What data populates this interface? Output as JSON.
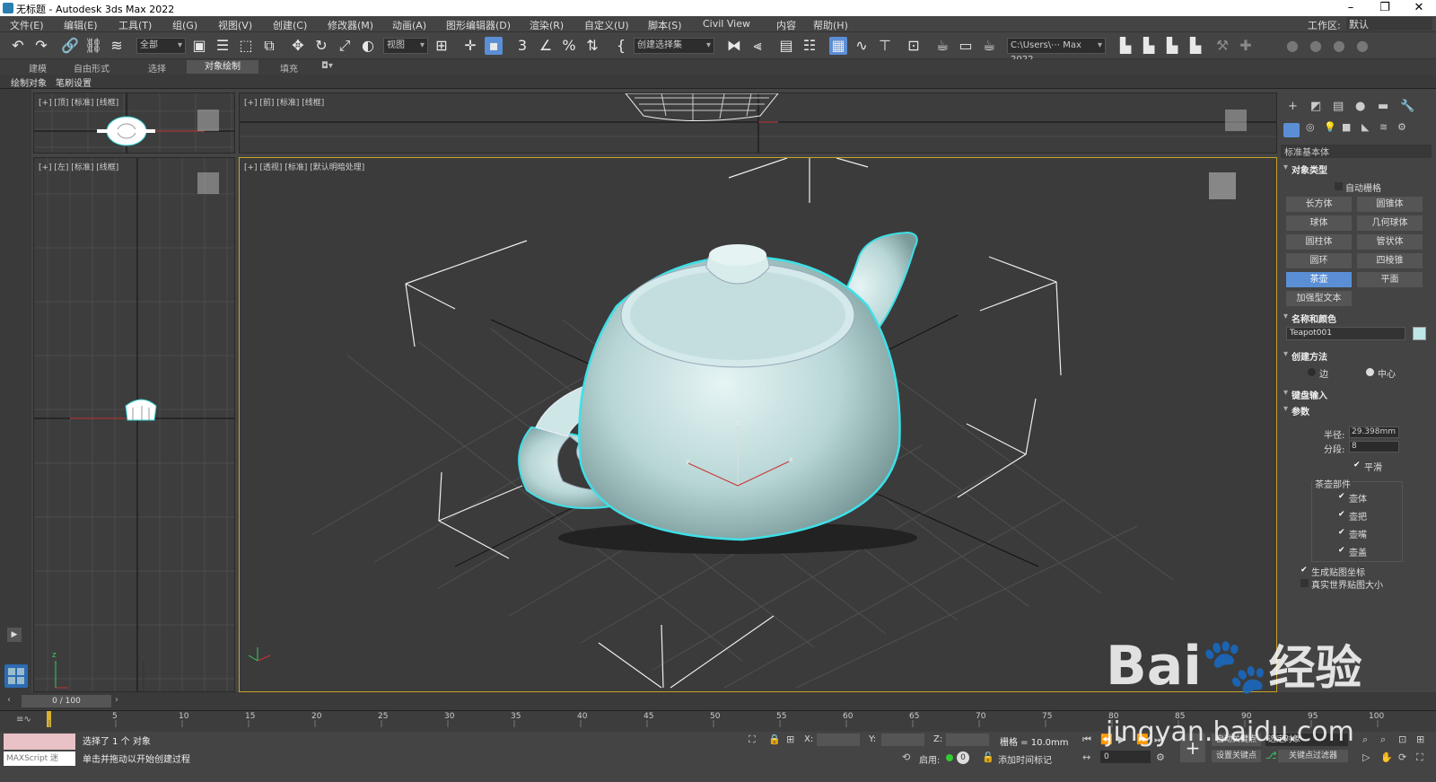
{
  "title": "无标题 - Autodesk 3ds Max 2022",
  "window_buttons": [
    "–",
    "❐",
    "✕"
  ],
  "menu": [
    "文件(E)",
    "编辑(E)",
    "工具(T)",
    "组(G)",
    "视图(V)",
    "创建(C)",
    "修改器(M)",
    "动画(A)",
    "图形编辑器(D)",
    "渲染(R)",
    "自定义(U)",
    "脚本(S)",
    "Civil View",
    "内容",
    "帮助(H)"
  ],
  "workspace": {
    "label": "工作区:",
    "value": "默认"
  },
  "toolbar": {
    "filter": "全部",
    "coord": "视图",
    "selection_set": "创建选择集",
    "path": "C:\\Users\\⋯ Max 2022",
    "snap_angle": "3"
  },
  "ribbon_tabs": [
    "建模",
    "自由形式",
    "选择",
    "对象绘制",
    "填充"
  ],
  "ribbon_active": "对象绘制",
  "subribbon": [
    "绘制对象",
    "笔刷设置"
  ],
  "viewports": {
    "top": "[+] [顶] [标准] [线框]",
    "front": "[+] [前] [标准] [线框]",
    "left": "[+] [左] [标准] [线框]",
    "persp": "[+] [透视] [标准] [默认明暗处理]"
  },
  "command_panel": {
    "category": "标准基本体",
    "object_type": "对象类型",
    "autogrid": "自动栅格",
    "objects": [
      "长方体",
      "圆锥体",
      "球体",
      "几何球体",
      "圆柱体",
      "管状体",
      "圆环",
      "四棱锥",
      "茶壶",
      "平面",
      "加强型文本"
    ],
    "selected_object": "茶壶",
    "name_color": "名称和颜色",
    "name": "Teapot001",
    "obj_color": "#bfe6e6",
    "creation_method": "创建方法",
    "method_edge": "边",
    "method_center": "中心",
    "keyboard_input": "键盘输入",
    "parameters": "参数",
    "radius_label": "半径:",
    "radius": "29.398mm",
    "segments_label": "分段:",
    "segments": "8",
    "smooth": "平滑",
    "parts_label": "茶壶部件",
    "parts": [
      "壶体",
      "壶把",
      "壶嘴",
      "壶盖"
    ],
    "gen_map": "生成贴图坐标",
    "real_world": "真实世界贴图大小"
  },
  "timeline": {
    "frame": "0 / 100",
    "ticks": [
      "5",
      "10",
      "15",
      "20",
      "25",
      "30",
      "35",
      "40",
      "45",
      "50",
      "55",
      "60",
      "65",
      "70",
      "75",
      "80",
      "85",
      "90",
      "95",
      "100"
    ]
  },
  "status": {
    "selected": "选择了 1 个 对象",
    "hint": "单击并拖动以开始创建过程",
    "maxscript": "MAXScript 迷",
    "x_label": "X:",
    "y_label": "Y:",
    "z_label": "Z:",
    "grid": "栅格 = 10.0mm",
    "enable": "启用:",
    "add_tag": "添加时间标记",
    "autokey": "自动关键点",
    "selected_obj": "选定对象",
    "setkey": "设置关键点",
    "keyfilter": "关键点过滤器",
    "frame_field": "0"
  },
  "watermark": {
    "brand": "Bai",
    "brand2": "经验",
    "url": "jingyan.baidu.com"
  },
  "accent": "#5a8fd6"
}
